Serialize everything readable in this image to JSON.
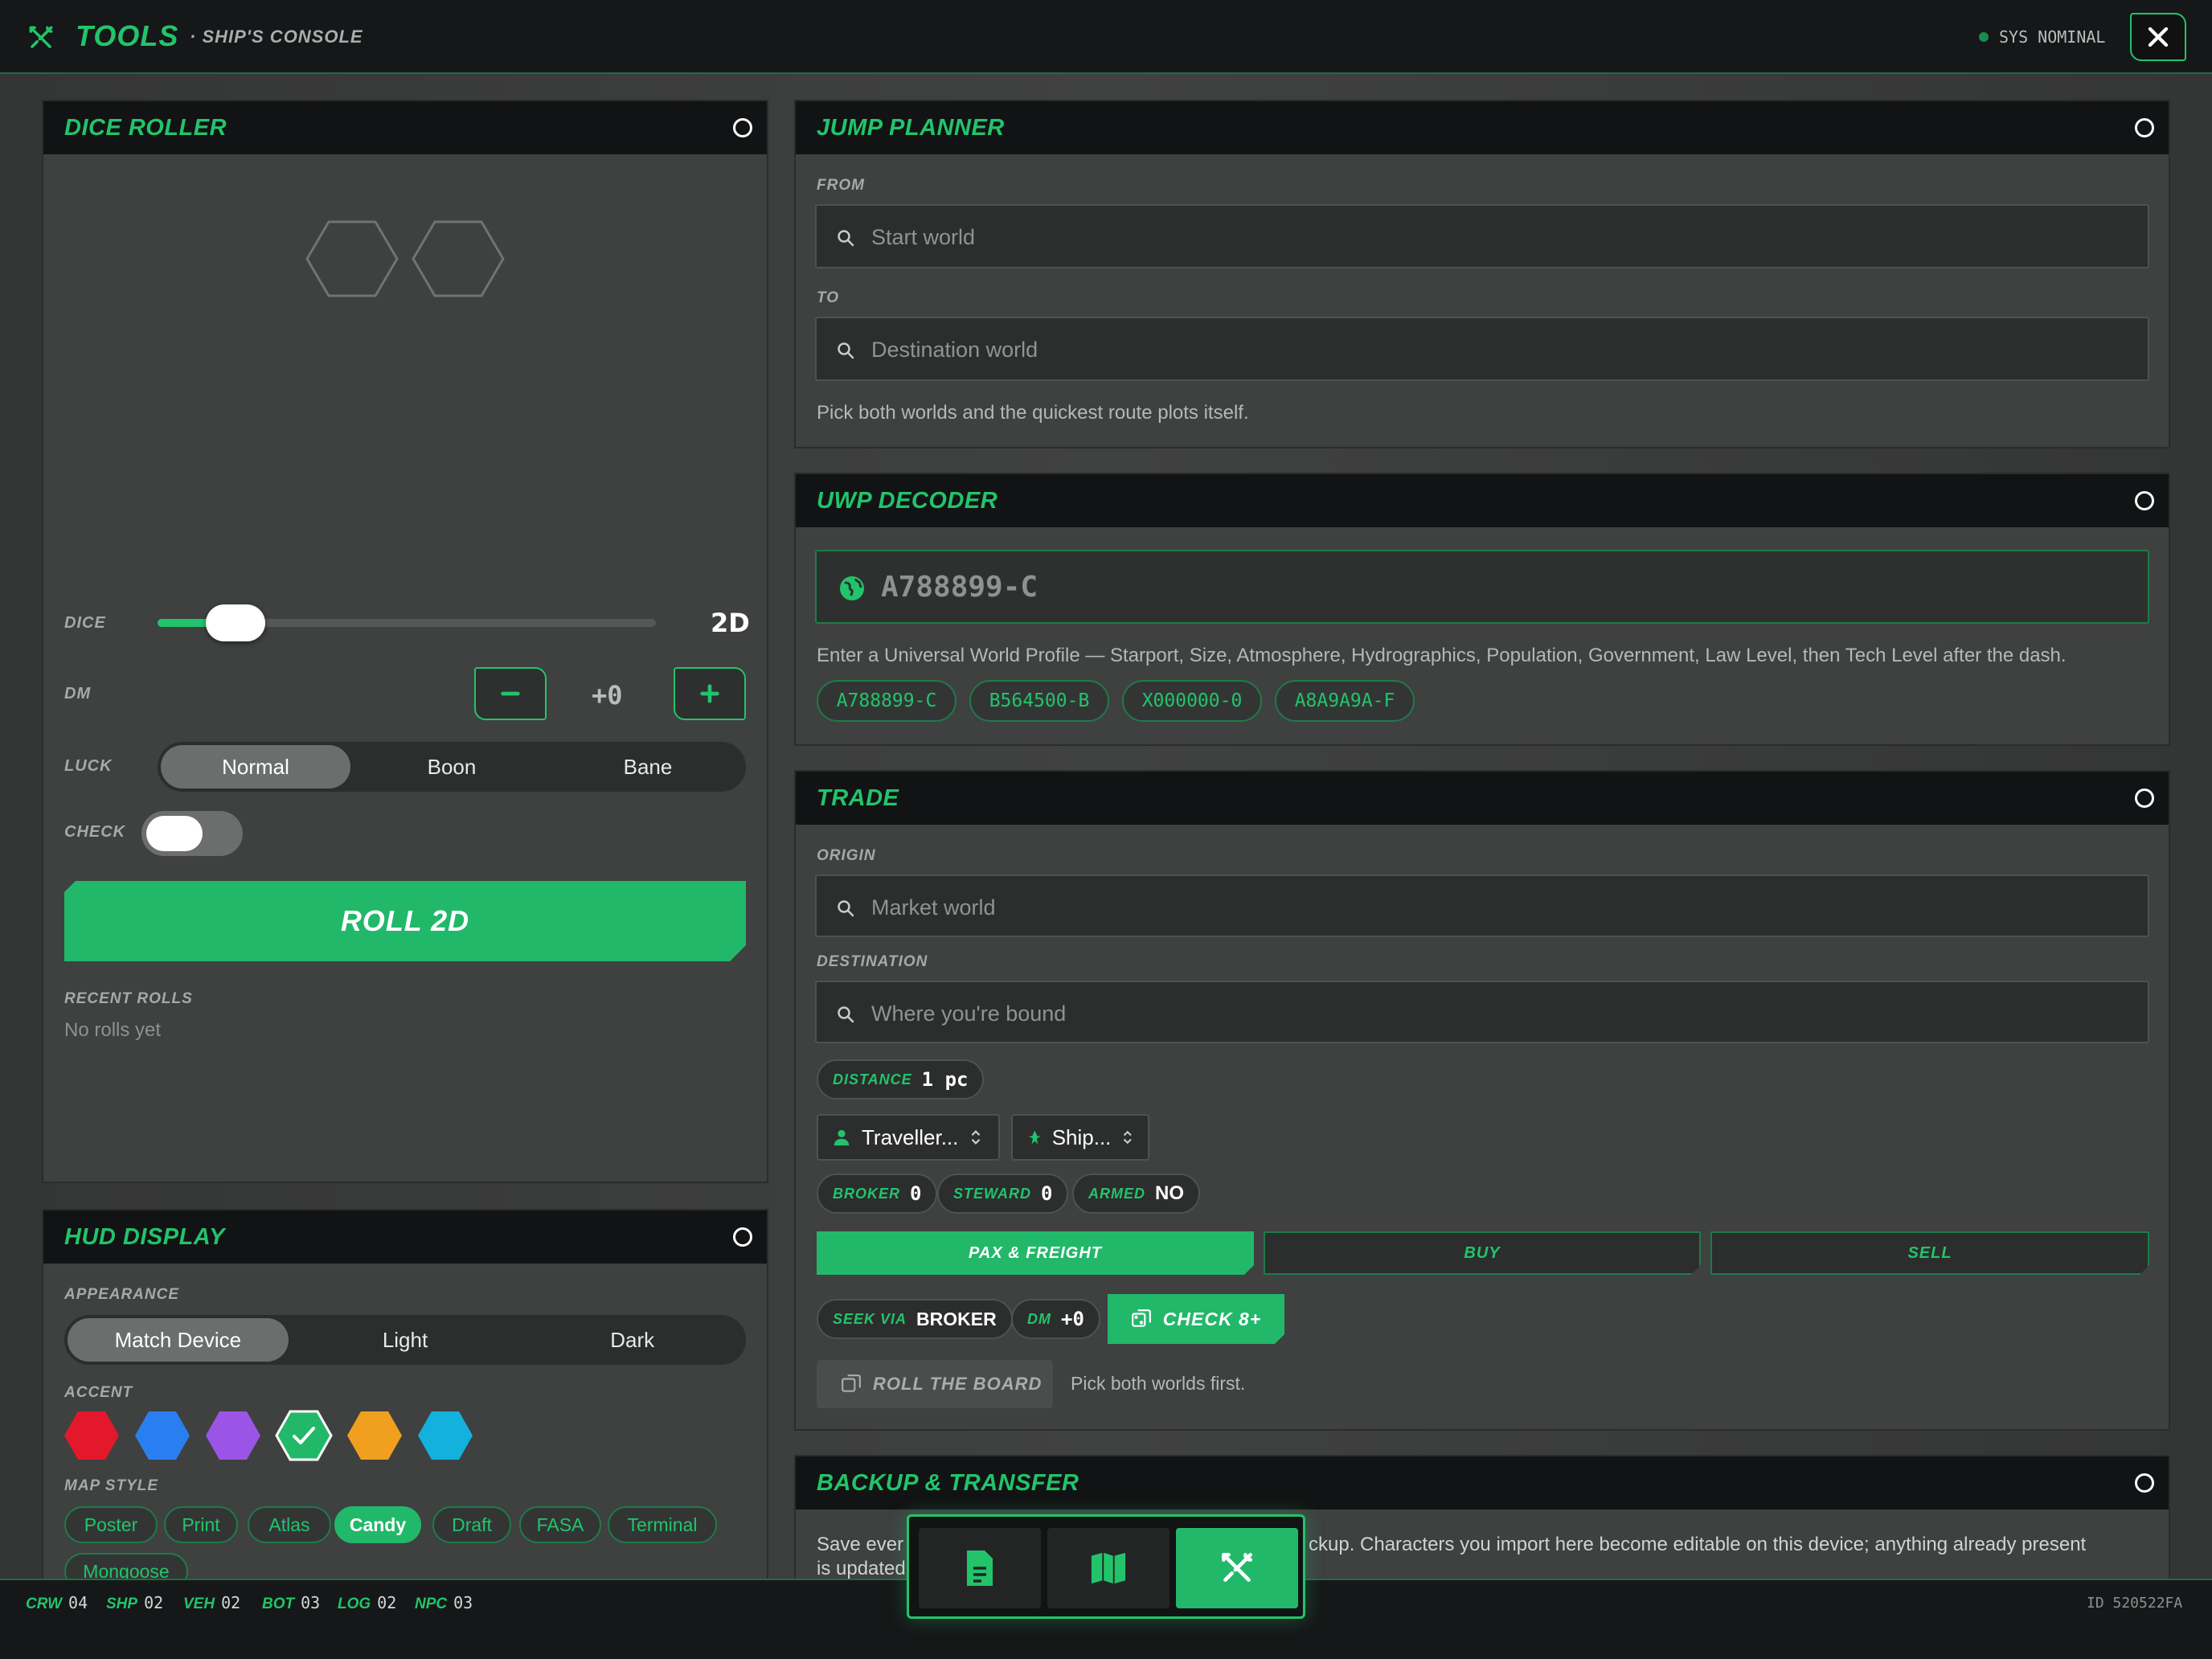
{
  "header": {
    "title": "TOOLS",
    "subtitle": "· SHIP'S CONSOLE",
    "status": "SYS NOMINAL"
  },
  "dice_roller": {
    "title": "DICE ROLLER",
    "dice_label": "DICE",
    "dice_value": "2D",
    "dice_count": 2,
    "dm_label": "DM",
    "dm_value": "+0",
    "luck_label": "LUCK",
    "luck_options": [
      "Normal",
      "Boon",
      "Bane"
    ],
    "luck_selected": "Normal",
    "check_label": "CHECK",
    "check_on": false,
    "roll_button": "ROLL 2D",
    "recent_label": "RECENT ROLLS",
    "recent_empty": "No rolls yet"
  },
  "hud_display": {
    "title": "HUD DISPLAY",
    "appearance_label": "APPEARANCE",
    "appearance_options": [
      "Match Device",
      "Light",
      "Dark"
    ],
    "appearance_selected": "Match Device",
    "accent_label": "ACCENT",
    "accent_colors": [
      "#e3192b",
      "#2a7ff0",
      "#9b55e6",
      "#22b86a",
      "#f0a01e",
      "#12b2dd"
    ],
    "accent_selected": 3,
    "map_style_label": "MAP STYLE",
    "map_styles": [
      "Poster",
      "Print",
      "Atlas",
      "Candy",
      "Draft",
      "FASA",
      "Terminal",
      "Mongoose"
    ],
    "map_style_selected": "Candy"
  },
  "jump_planner": {
    "title": "JUMP PLANNER",
    "from_label": "FROM",
    "from_placeholder": "Start world",
    "to_label": "TO",
    "to_placeholder": "Destination world",
    "hint": "Pick both worlds and the quickest route plots itself."
  },
  "uwp_decoder": {
    "title": "UWP DECODER",
    "value": "A788899-C",
    "hint": "Enter a Universal World Profile — Starport, Size, Atmosphere, Hydrographics, Population, Government, Law Level, then Tech Level after the dash.",
    "examples": [
      "A788899-C",
      "B564500-B",
      "X000000-0",
      "A8A9A9A-F"
    ]
  },
  "trade": {
    "title": "TRADE",
    "origin_label": "ORIGIN",
    "origin_placeholder": "Market world",
    "destination_label": "DESTINATION",
    "destination_placeholder": "Where you're bound",
    "distance_label": "DISTANCE",
    "distance_value": "1 pc",
    "traveller_select": "Traveller...",
    "ship_select": "Ship...",
    "broker_label": "BROKER",
    "broker_value": "0",
    "steward_label": "STEWARD",
    "steward_value": "0",
    "armed_label": "ARMED",
    "armed_value": "NO",
    "tabs": [
      "PAX & FREIGHT",
      "BUY",
      "SELL"
    ],
    "tab_selected": "PAX & FREIGHT",
    "seek_label": "SEEK VIA",
    "seek_value": "BROKER",
    "dm_label": "DM",
    "dm_value": "+0",
    "check_button": "CHECK 8+",
    "board_button": "ROLL THE BOARD",
    "board_hint": "Pick both worlds first."
  },
  "backup": {
    "title": "BACKUP & TRANSFER",
    "text_left": "Save ever",
    "text_right": "ckup. Characters you import here become editable on this device; anything already present",
    "text_line2": "is updated"
  },
  "statusbar": {
    "items": [
      {
        "key": "CRW",
        "value": "04"
      },
      {
        "key": "SHP",
        "value": "02"
      },
      {
        "key": "VEH",
        "value": "02"
      },
      {
        "key": "BOT",
        "value": "03"
      },
      {
        "key": "LOG",
        "value": "02"
      },
      {
        "key": "NPC",
        "value": "03"
      }
    ],
    "id": "ID 520522FA"
  },
  "dock": {
    "items": [
      "document-icon",
      "map-icon",
      "tools-icon"
    ],
    "active": "tools-icon"
  }
}
